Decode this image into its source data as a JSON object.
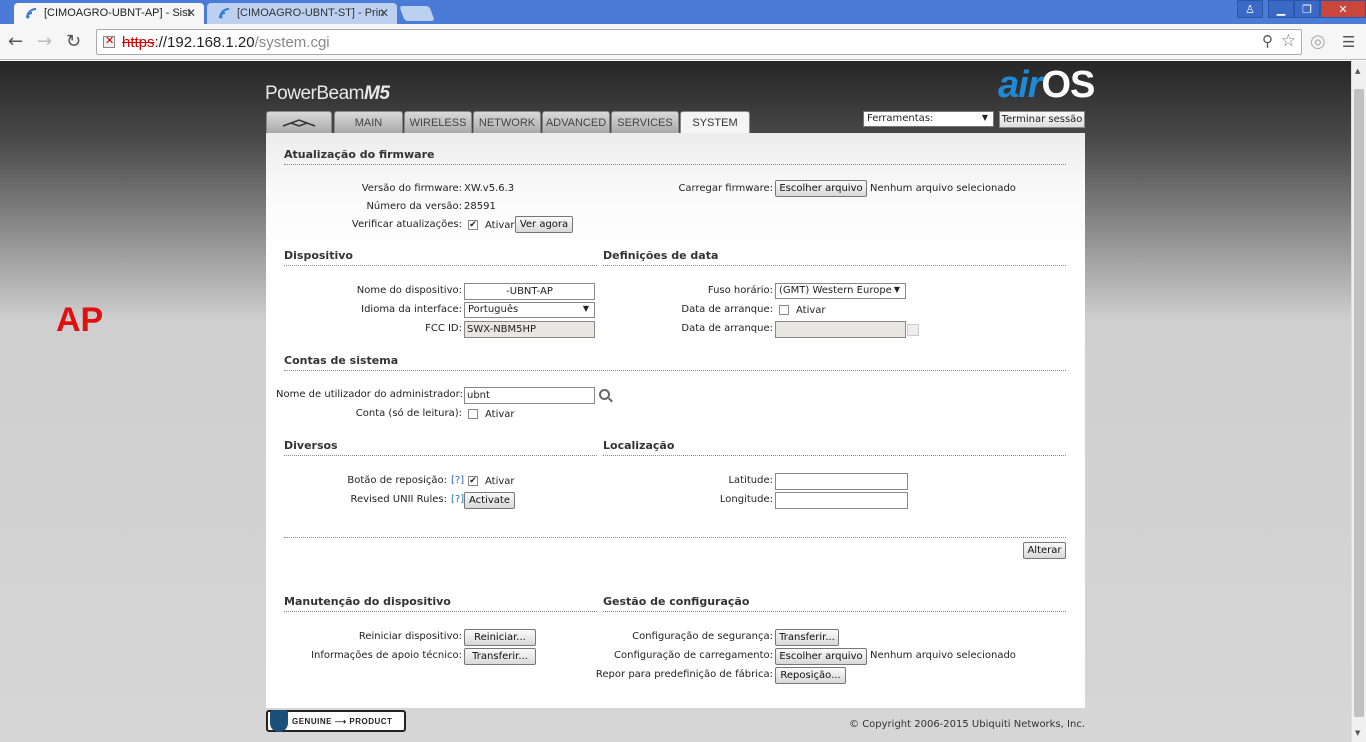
{
  "browser": {
    "tabs": [
      {
        "label": "[CIMOAGRO-UBNT-AP] - Sist",
        "active": true
      },
      {
        "label": "[CIMOAGRO-UBNT-ST] - Prin",
        "active": false
      }
    ],
    "url_protocol": "https",
    "url_host": "://192.168.1.20",
    "url_path": "/system.cgi"
  },
  "overlay_label": "AP",
  "header": {
    "brand": "PowerBeam",
    "brand_model": "M5",
    "os_logo_air": "air",
    "os_logo_os": "OS",
    "tabs": [
      "MAIN",
      "WIRELESS",
      "NETWORK",
      "ADVANCED",
      "SERVICES",
      "SYSTEM"
    ],
    "tools_label": "Ferramentas:",
    "logout_label": "Terminar sessão"
  },
  "firmware": {
    "title": "Atualização do firmware",
    "version_label": "Versão do firmware:",
    "version_value": "XW.v5.6.3",
    "build_label": "Número da versão:",
    "build_value": "28591",
    "check_label": "Verificar atualizações:",
    "check_option": "Ativar",
    "check_now": "Ver agora",
    "upload_label": "Carregar firmware:",
    "choose_file": "Escolher arquivo",
    "no_file": "Nenhum arquivo selecionado"
  },
  "device": {
    "title": "Dispositivo",
    "name_label": "Nome do dispositivo:",
    "name_value": "-UBNT-AP",
    "lang_label": "Idioma da interface:",
    "lang_value": "Português",
    "fcc_label": "FCC ID:",
    "fcc_value": "SWX-NBM5HP"
  },
  "date": {
    "title": "Definições de data",
    "tz_label": "Fuso horário:",
    "tz_value": "(GMT) Western Europe",
    "startup_label": "Data de arranque:",
    "startup_option": "Ativar",
    "startup_date_label": "Data de arranque:"
  },
  "accounts": {
    "title": "Contas de sistema",
    "admin_label": "Nome de utilizador do administrador:",
    "admin_value": "ubnt",
    "readonly_label": "Conta (só de leitura):",
    "readonly_option": "Ativar"
  },
  "misc": {
    "title": "Diversos",
    "reset_label": "Botão de reposição:",
    "help": "[?]",
    "reset_option": "Ativar",
    "unii_label": "Revised UNII Rules:",
    "unii_button": "Activate"
  },
  "location": {
    "title": "Localização",
    "lat_label": "Latitude:",
    "lon_label": "Longitude:"
  },
  "change_button": "Alterar",
  "maintenance": {
    "title": "Manutenção do dispositivo",
    "reboot_label": "Reiniciar dispositivo:",
    "reboot_button": "Reiniciar...",
    "support_label": "Informações de apoio técnico:",
    "support_button": "Transferir..."
  },
  "config": {
    "title": "Gestão de configuração",
    "backup_label": "Configuração de segurança:",
    "backup_button": "Transferir...",
    "upload_label": "Configuração de carregamento:",
    "choose_file": "Escolher arquivo",
    "no_file": "Nenhum arquivo selecionado",
    "reset_label": "Repor para predefinição de fábrica:",
    "reset_button": "Reposição..."
  },
  "footer": {
    "genuine": "GENUINE ⟶ PRODUCT",
    "copyright": "© Copyright 2006-2015 Ubiquiti Networks, Inc."
  },
  "colors": {
    "os_blue": "#1f8ad6",
    "ap_red": "#e01010",
    "tab_bar": "#4a7bd6"
  }
}
